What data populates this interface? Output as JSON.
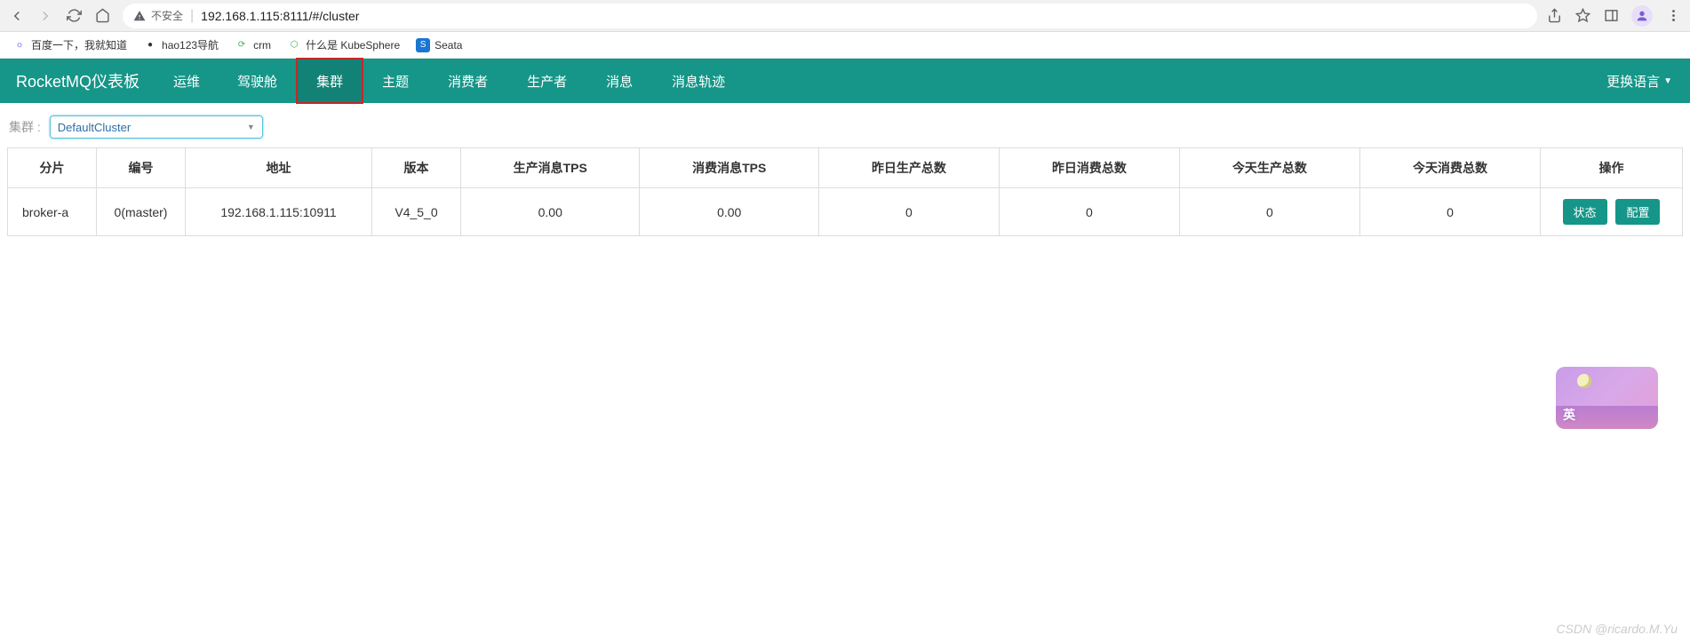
{
  "browser": {
    "security_label": "不安全",
    "url": "192.168.1.115:8111/#/cluster"
  },
  "bookmarks": [
    {
      "label": "百度一下，我就知道",
      "color": "#2932e1",
      "glyph": "☼"
    },
    {
      "label": "hao123导航",
      "color": "#333",
      "glyph": "●"
    },
    {
      "label": "crm",
      "color": "#4caf50",
      "glyph": "⟳"
    },
    {
      "label": "什么是 KubeSphere",
      "color": "#4caf50",
      "glyph": "⬡"
    },
    {
      "label": "Seata",
      "color": "#1976d2",
      "glyph": "S"
    }
  ],
  "navbar": {
    "brand": "RocketMQ仪表板",
    "links": [
      "运维",
      "驾驶舱",
      "集群",
      "主题",
      "消费者",
      "生产者",
      "消息",
      "消息轨迹"
    ],
    "active_index": 2,
    "language": "更换语言"
  },
  "filter": {
    "label": "集群 :",
    "selected": "DefaultCluster"
  },
  "table": {
    "headers": [
      "分片",
      "编号",
      "地址",
      "版本",
      "生产消息TPS",
      "消费消息TPS",
      "昨日生产总数",
      "昨日消费总数",
      "今天生产总数",
      "今天消费总数",
      "操作"
    ],
    "rows": [
      {
        "shard": "broker-a",
        "id": "0(master)",
        "addr": "192.168.1.115:10911",
        "version": "V4_5_0",
        "prod_tps": "0.00",
        "cons_tps": "0.00",
        "y_prod": "0",
        "y_cons": "0",
        "t_prod": "0",
        "t_cons": "0"
      }
    ],
    "op_status": "状态",
    "op_config": "配置"
  },
  "watermark": "CSDN @ricardo.M.Yu",
  "float_glyph": "英"
}
